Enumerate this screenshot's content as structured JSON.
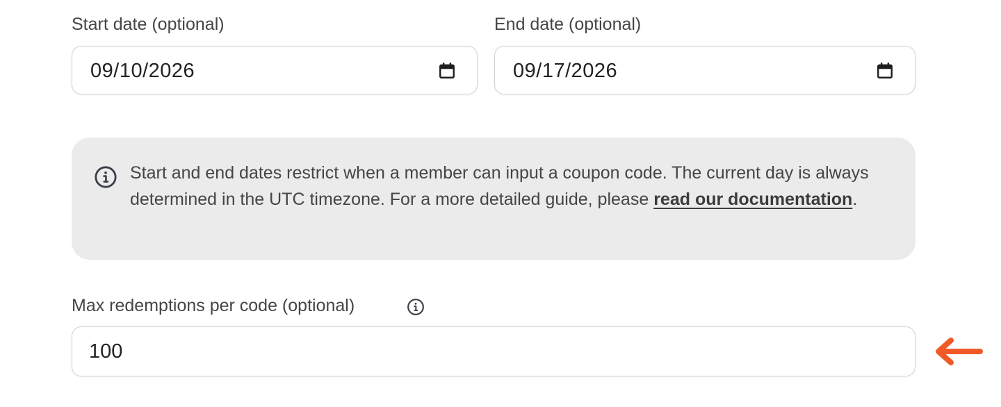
{
  "start_date": {
    "label": "Start date (optional)",
    "value": "09/10/2026",
    "icon": "calendar-icon"
  },
  "end_date": {
    "label": "End date (optional)",
    "value": "09/17/2026",
    "icon": "calendar-icon"
  },
  "info_box": {
    "icon": "info-icon",
    "text_before": "Start and end dates restrict when a member can input a coupon code. The current day is always determined in the UTC timezone. For a more detailed guide, please ",
    "link_text": "read our documentation",
    "text_after": "."
  },
  "max_redemptions": {
    "label": "Max redemptions per code (optional)",
    "label_icon": "info-icon",
    "value": "100"
  },
  "annotation": {
    "icon": "arrow-left-icon",
    "color": "#f05a28"
  }
}
